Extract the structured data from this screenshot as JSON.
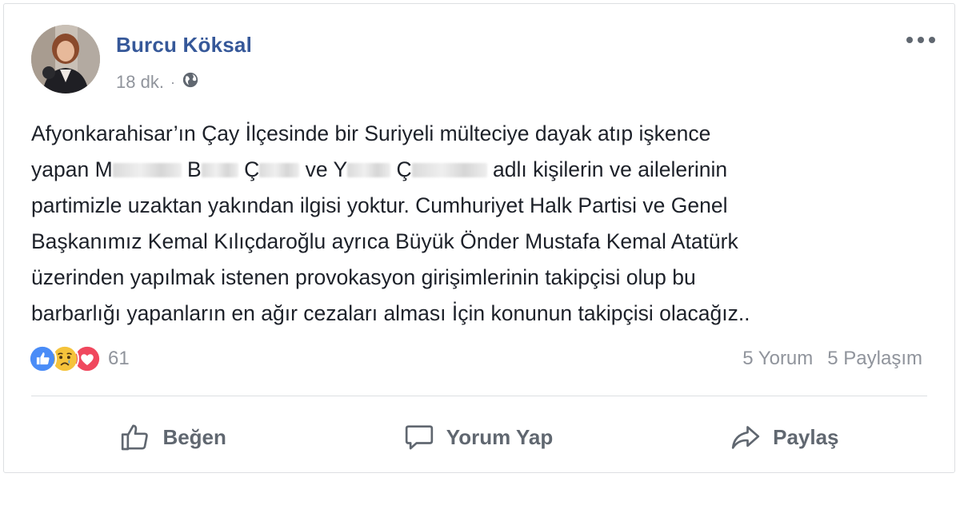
{
  "post": {
    "author": "Burcu Köksal",
    "time": "18 dk.",
    "separator": "·",
    "privacy_icon": "globe-icon",
    "text_lines": {
      "l1": "Afyonkarahisar’ın Çay İlçesinde bir Suriyeli mülteciye dayak atıp işkence",
      "l2_a": "yapan M",
      "l2_b": "B",
      "l2_c": "Ç",
      "l2_d": "ve Y",
      "l2_e": "Ç",
      "l2_f": "adlı kişilerin ve ailelerinin",
      "l3": "partimizle uzaktan yakından ilgisi yoktur. Cumhuriyet Halk Partisi ve Genel",
      "l4": "Başkanımız Kemal Kılıçdaroğlu ayrıca Büyük Önder Mustafa Kemal Atatürk",
      "l5": "üzerinden yapılmak istenen provokasyon girişimlerinin takipçisi olup bu",
      "l6": "barbarlığı yapanların en ağır cezaları alması İçin konunun takipçisi olacağız.."
    }
  },
  "reactions": {
    "icons": [
      "like-reaction-icon",
      "sad-reaction-icon",
      "love-reaction-icon"
    ],
    "count": "61",
    "colors": {
      "like": "#4a8cf7",
      "sad": "#f5c33b",
      "love": "#f0485e"
    }
  },
  "stats": {
    "comments": "5 Yorum",
    "shares": "5 Paylaşım"
  },
  "actions": {
    "like": "Beğen",
    "comment": "Yorum Yap",
    "share": "Paylaş"
  },
  "theme": {
    "author_color": "#365899",
    "meta_color": "#90949c",
    "action_color": "#606770"
  }
}
